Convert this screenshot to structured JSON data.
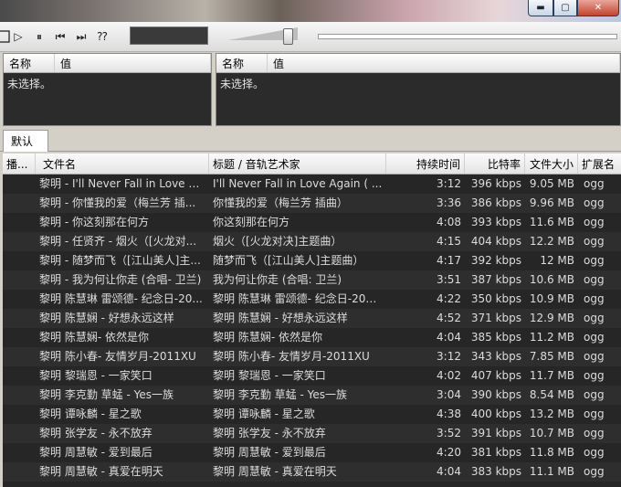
{
  "window": {
    "min_glyph": "▬",
    "max_glyph": "▢",
    "close_glyph": "✕"
  },
  "toolbar": {
    "play_glyph": "▷",
    "pause_glyph": "⏸",
    "prev_glyph": "⏮",
    "next_glyph": "⏭",
    "random_glyph": "⁇"
  },
  "properties_left": {
    "col_name": "名称",
    "col_value": "值",
    "empty_text": "未选择。"
  },
  "properties_right": {
    "col_name": "名称",
    "col_value": "值",
    "empty_text": "未选择。"
  },
  "playlist": {
    "tab_label": "默认",
    "columns": {
      "playing": "播...",
      "filename": "文件名",
      "title_artist": "标题 / 音轨艺术家",
      "duration": "持续时间",
      "bitrate": "比特率",
      "filesize": "文件大小",
      "extension": "扩展名"
    },
    "rows": [
      {
        "file": "黎明 - I'll Never Fall in Love A...",
        "title": "I'll Never Fall in Love Again ( ...",
        "dur": "3:12",
        "rate": "396 kbps",
        "size": "9.05 MB",
        "ext": "ogg"
      },
      {
        "file": "黎明 - 你懂我的爱（梅兰芳 插...",
        "title": "你懂我的爱（梅兰芳 插曲）",
        "dur": "3:36",
        "rate": "386 kbps",
        "size": "9.96 MB",
        "ext": "ogg"
      },
      {
        "file": "黎明 - 你这刻那在何方",
        "title": "你这刻那在何方",
        "dur": "4:08",
        "rate": "393 kbps",
        "size": "11.6 MB",
        "ext": "ogg"
      },
      {
        "file": "黎明 - 任贤齐 - 烟火（[火龙对...",
        "title": "烟火（[火龙对决]主题曲）",
        "dur": "4:15",
        "rate": "404 kbps",
        "size": "12.2 MB",
        "ext": "ogg"
      },
      {
        "file": "黎明 - 随梦而飞（[江山美人]主...",
        "title": "随梦而飞（[江山美人]主题曲）",
        "dur": "4:17",
        "rate": "392 kbps",
        "size": "12 MB",
        "ext": "ogg"
      },
      {
        "file": "黎明 - 我为何让你走 (合唱- 卫兰)",
        "title": "我为何让你走 (合唱: 卫兰)",
        "dur": "3:51",
        "rate": "387 kbps",
        "size": "10.6 MB",
        "ext": "ogg"
      },
      {
        "file": "黎明 陈慧琳 雷颂德- 纪念日-20...",
        "title": "黎明 陈慧琳 雷颂德- 纪念日-201...",
        "dur": "4:22",
        "rate": "350 kbps",
        "size": "10.9 MB",
        "ext": "ogg"
      },
      {
        "file": "黎明 陈慧娴 - 好想永远这样",
        "title": "黎明 陈慧娴 - 好想永远这样",
        "dur": "4:52",
        "rate": "371 kbps",
        "size": "12.9 MB",
        "ext": "ogg"
      },
      {
        "file": "黎明 陈慧娴- 依然是你",
        "title": "黎明 陈慧娴- 依然是你",
        "dur": "4:04",
        "rate": "385 kbps",
        "size": "11.2 MB",
        "ext": "ogg"
      },
      {
        "file": "黎明 陈小春- 友情岁月-2011XU",
        "title": "黎明 陈小春- 友情岁月-2011XU",
        "dur": "3:12",
        "rate": "343 kbps",
        "size": "7.85 MB",
        "ext": "ogg"
      },
      {
        "file": "黎明 黎瑞恩 - 一家笑口",
        "title": "黎明 黎瑞恩 - 一家笑口",
        "dur": "4:02",
        "rate": "407 kbps",
        "size": "11.7 MB",
        "ext": "ogg"
      },
      {
        "file": "黎明 李克勤 草蜢 - Yes一族",
        "title": "黎明 李克勤 草蜢 - Yes一族",
        "dur": "3:04",
        "rate": "390 kbps",
        "size": "8.54 MB",
        "ext": "ogg"
      },
      {
        "file": "黎明 谭咏麟 - 星之歌",
        "title": "黎明 谭咏麟 - 星之歌",
        "dur": "4:38",
        "rate": "400 kbps",
        "size": "13.2 MB",
        "ext": "ogg"
      },
      {
        "file": "黎明 张学友 - 永不放弃",
        "title": "黎明 张学友 - 永不放弃",
        "dur": "3:52",
        "rate": "391 kbps",
        "size": "10.7 MB",
        "ext": "ogg"
      },
      {
        "file": "黎明 周慧敏 - 爱到最后",
        "title": "黎明 周慧敏 - 爱到最后",
        "dur": "4:20",
        "rate": "381 kbps",
        "size": "11.8 MB",
        "ext": "ogg"
      },
      {
        "file": "黎明 周慧敏 - 真爱在明天",
        "title": "黎明 周慧敏 - 真爱在明天",
        "dur": "4:04",
        "rate": "383 kbps",
        "size": "11.1 MB",
        "ext": "ogg"
      }
    ]
  }
}
